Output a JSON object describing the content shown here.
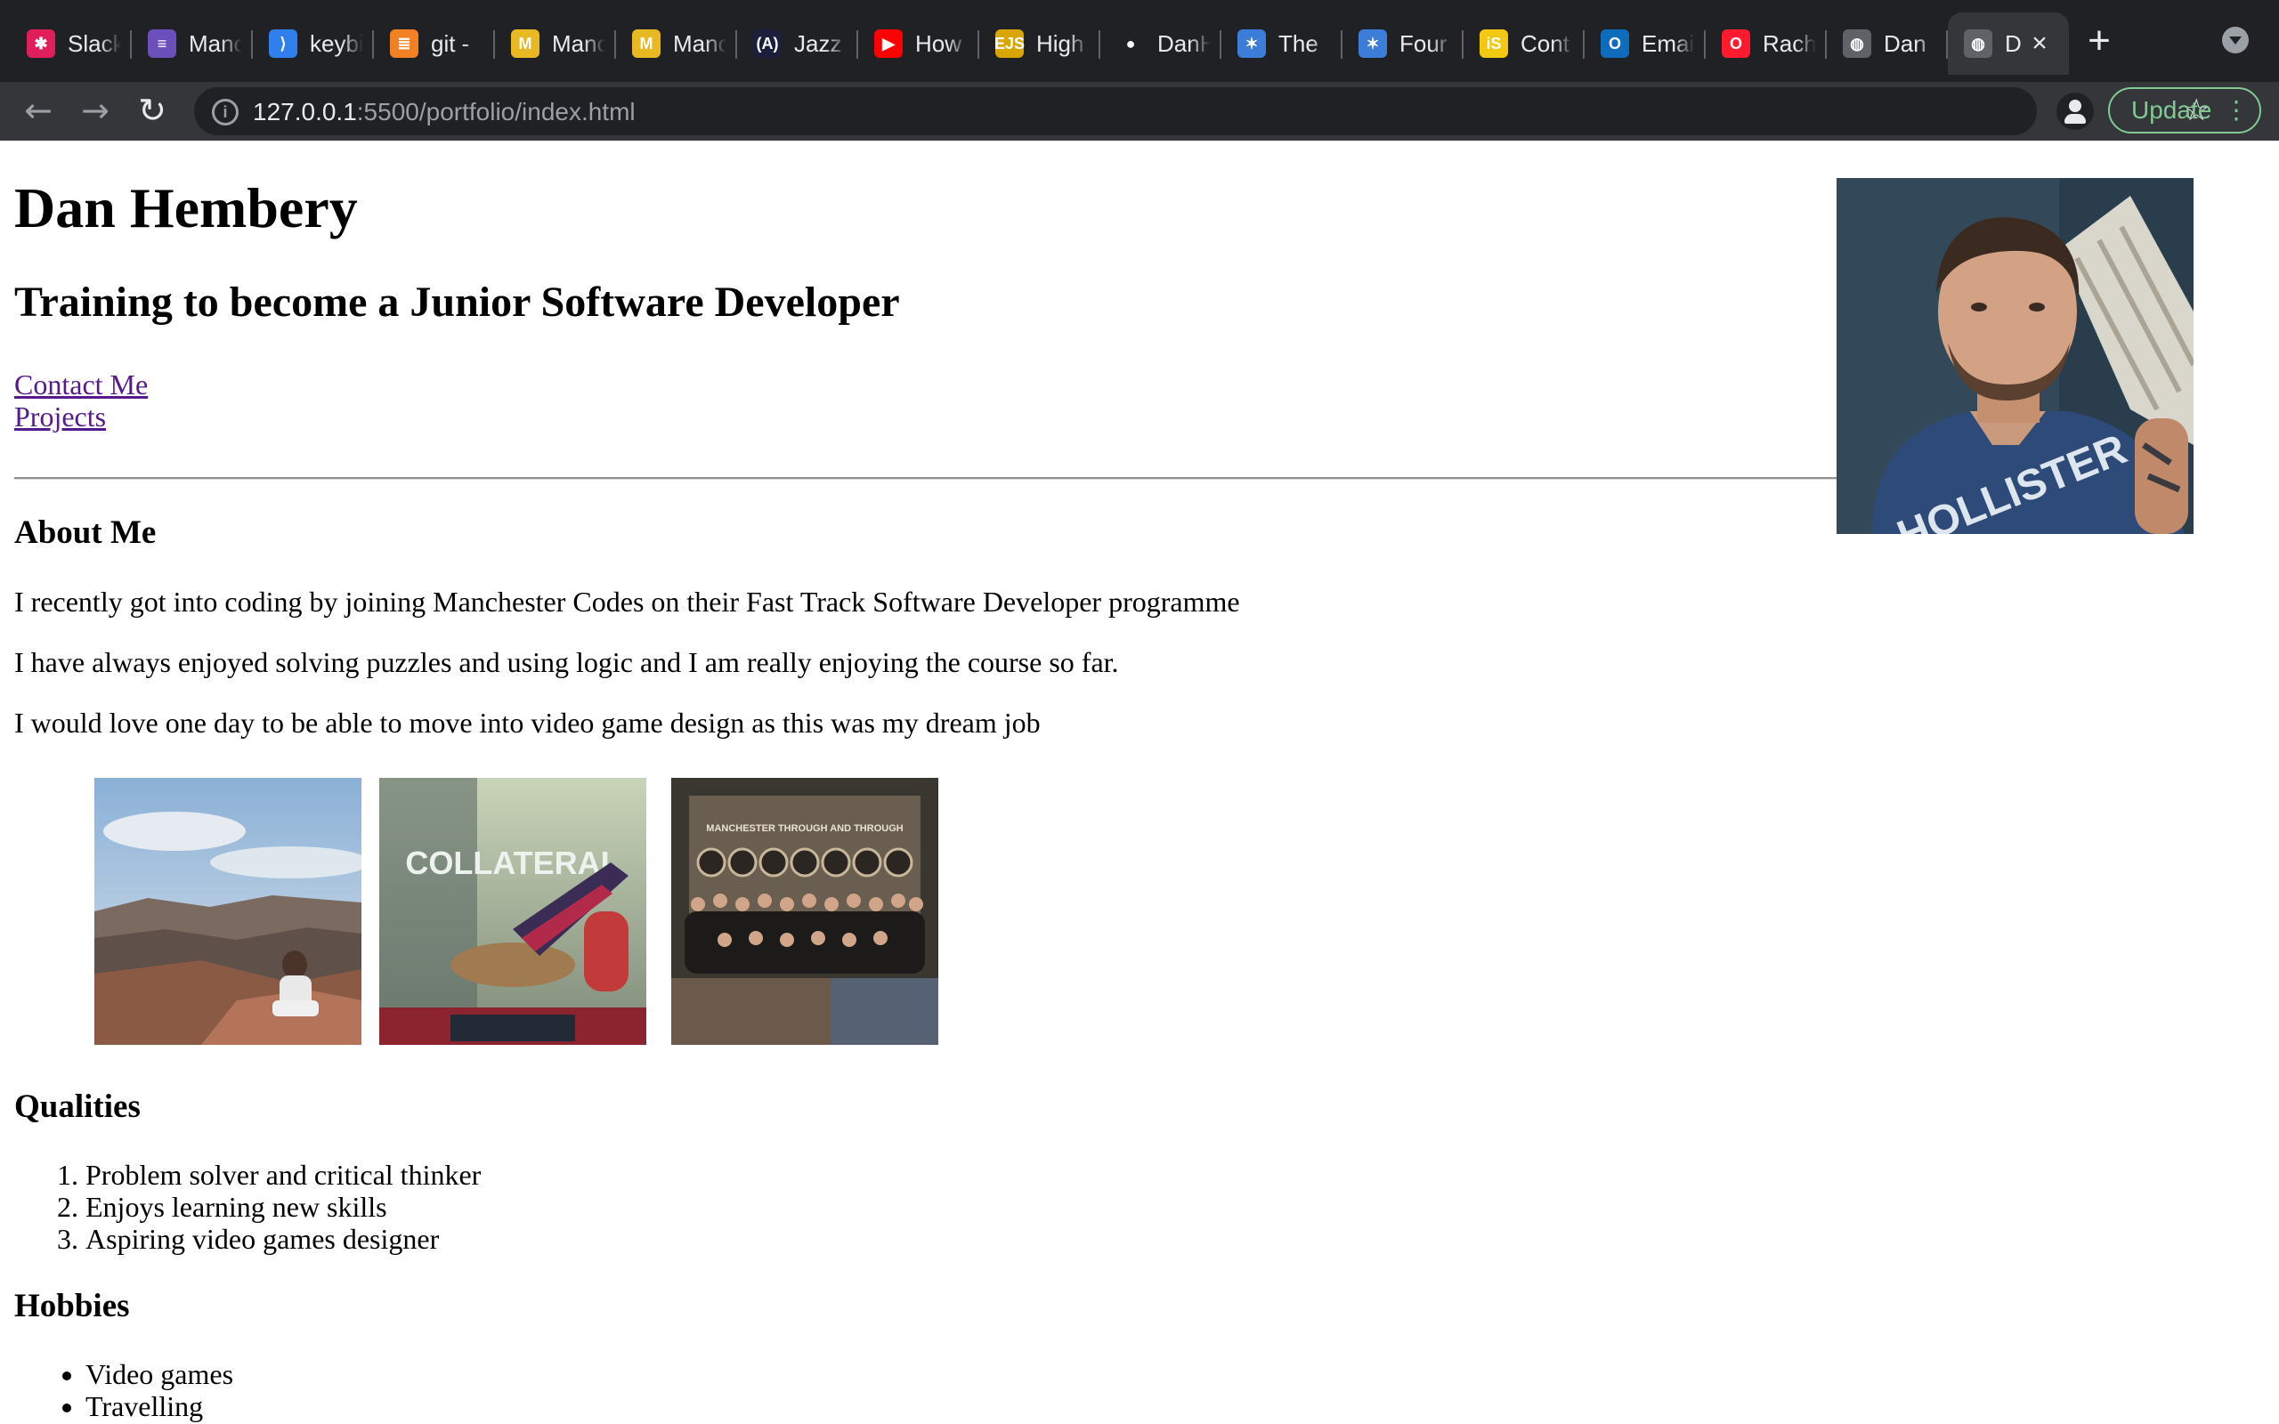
{
  "browser": {
    "tabs": [
      {
        "label": "Slack",
        "icon": "slack-icon",
        "color": "#e01e5a",
        "glyph": "✱"
      },
      {
        "label": "Manchester",
        "icon": "list-icon",
        "color": "#6b4fbb",
        "glyph": "≡"
      },
      {
        "label": "keybindings",
        "icon": "vscode-icon",
        "color": "#2f80ed",
        "glyph": "⟩"
      },
      {
        "label": "git -",
        "icon": "stackoverflow-icon",
        "color": "#f48024",
        "glyph": "≣"
      },
      {
        "label": "Manchester",
        "icon": "manchester-codes-icon",
        "color": "#e8b923",
        "glyph": "M"
      },
      {
        "label": "Manchester",
        "icon": "manchester-codes-icon",
        "color": "#e8b923",
        "glyph": "M"
      },
      {
        "label": "Jazz",
        "icon": "jasmine-icon",
        "color": "#1b1f3b",
        "glyph": "(A)"
      },
      {
        "label": "How",
        "icon": "youtube-icon",
        "color": "#ff0000",
        "glyph": "▶"
      },
      {
        "label": "High",
        "icon": "ejs-icon",
        "color": "#d9a500",
        "glyph": "EJS"
      },
      {
        "label": "DanH",
        "icon": "github-icon",
        "color": "#202124",
        "glyph": "●"
      },
      {
        "label": "The",
        "icon": "tool-icon",
        "color": "#3b7dd8",
        "glyph": "✶"
      },
      {
        "label": "Four",
        "icon": "tool-icon",
        "color": "#3b7dd8",
        "glyph": "✶"
      },
      {
        "label": "Cont",
        "icon": "js-icon",
        "color": "#f2c811",
        "glyph": "iS"
      },
      {
        "label": "Email",
        "icon": "outlook-icon",
        "color": "#0f6cbd",
        "glyph": "O"
      },
      {
        "label": "Rach",
        "icon": "opera-icon",
        "color": "#ff1b2d",
        "glyph": "O"
      },
      {
        "label": "Dan",
        "icon": "globe-icon",
        "color": "#5f6368",
        "glyph": "◍"
      },
      {
        "label": "D",
        "icon": "globe-icon",
        "color": "#5f6368",
        "glyph": "◍",
        "active": true
      }
    ],
    "new_tab": "+",
    "url_host": "127.0.0.1",
    "url_path": ":5500/portfolio/index.html",
    "update_label": "Update"
  },
  "page": {
    "name": "Dan Hembery",
    "subtitle": "Training to become a Junior Software Developer",
    "nav": {
      "contact": "Contact Me",
      "projects": "Projects"
    },
    "about": {
      "heading": "About Me",
      "paragraphs": [
        "I recently got into coding by joining Manchester Codes on their Fast Track Software Developer programme",
        "I have always enjoyed solving puzzles and using logic and I am really enjoying the course so far.",
        "I would love one day to be able to move into video game design as this was my dream job"
      ]
    },
    "photos": [
      {
        "name": "grand-canyon-photo"
      },
      {
        "name": "collateral-game-photo",
        "caption": "COLLATERAL"
      },
      {
        "name": "group-photo",
        "caption": "MANCHESTER THROUGH AND THROUGH"
      }
    ],
    "qualities": {
      "heading": "Qualities",
      "items": [
        "Problem solver and critical thinker",
        "Enjoys learning new skills",
        "Aspiring video games designer"
      ]
    },
    "hobbies": {
      "heading": "Hobbies",
      "items": [
        "Video games",
        "Travelling"
      ]
    },
    "portrait_shirt_text": "HOLLISTER"
  }
}
